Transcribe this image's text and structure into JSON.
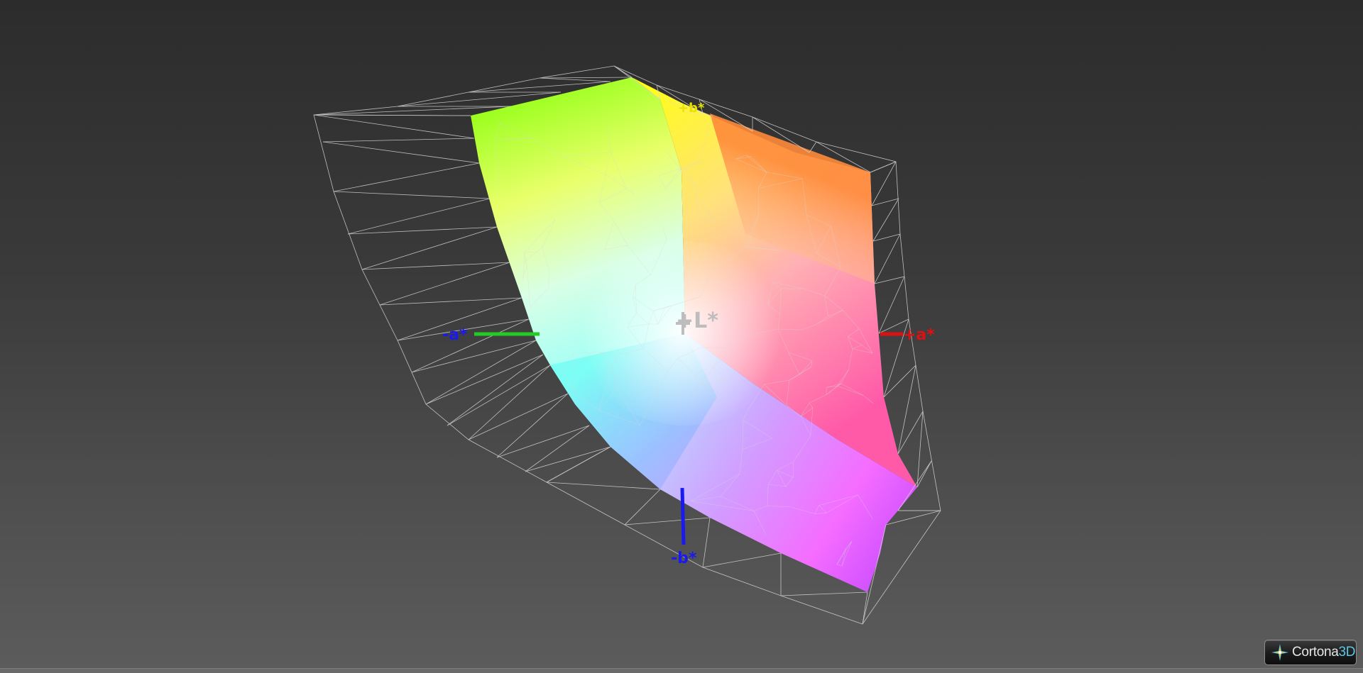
{
  "viewer": {
    "brand_name": "Cortona",
    "brand_suffix": "3D",
    "colors": {
      "background_top": "#2c2c2c",
      "background_bottom": "#5c5c5c",
      "wireframe": "#d8d8d8",
      "axis_plus_a": "#dd1111",
      "axis_minus_a": "#22cc22",
      "axis_minus_b": "#1a1aee",
      "axis_plus_b": "#e8e000",
      "axis_L": "#bdbdbd"
    }
  },
  "axes": {
    "plus_L": "+L*",
    "minus_a": "-a*",
    "plus_a": "+a*",
    "minus_b": "-b*",
    "plus_b": "+b*"
  },
  "icons": {
    "logo": "cortona-star-icon"
  }
}
